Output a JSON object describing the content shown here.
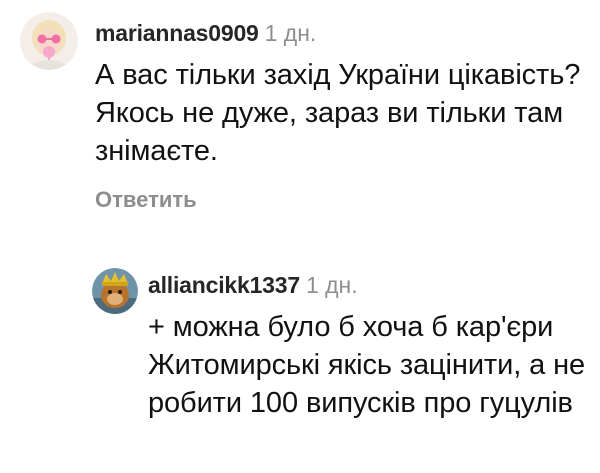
{
  "comments": [
    {
      "username": "mariannas0909",
      "time": "1 дн.",
      "text": "А вас тільки захід України цікавість? Якось не дуже, зараз ви тільки там знімаєте.",
      "reply_label": "Ответить",
      "avatar_icon": "user-avatar-pink-icon"
    },
    {
      "username": "alliancikk1337",
      "time": "1 дн.",
      "text": "+ можна було б хоча б кар'єри Житомирські якісь зацінити, а не робити 100 випусків про гуцулів",
      "avatar_icon": "user-avatar-crown-icon"
    }
  ],
  "colors": {
    "username": "#262626",
    "muted": "#8e8e8e",
    "text": "#111111",
    "background": "#ffffff"
  }
}
